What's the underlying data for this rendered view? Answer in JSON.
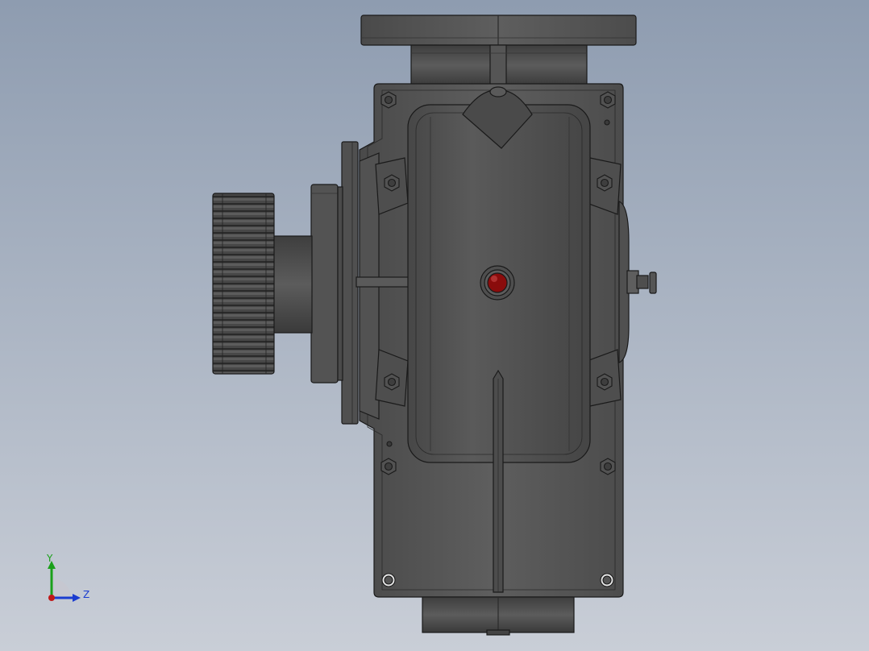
{
  "viewport": {
    "background_top": "#8e9cb0",
    "background_bottom": "#c9ced7"
  },
  "model": {
    "body_color": "#5a5a5a",
    "edge_color": "#1a1a1a",
    "sight_glass_color": "#8a0c0c"
  },
  "triad": {
    "y_label": "Y",
    "z_label": "Z",
    "y_color": "#1aa01a",
    "z_color": "#1a3cd0",
    "x_color": "#c01818"
  }
}
